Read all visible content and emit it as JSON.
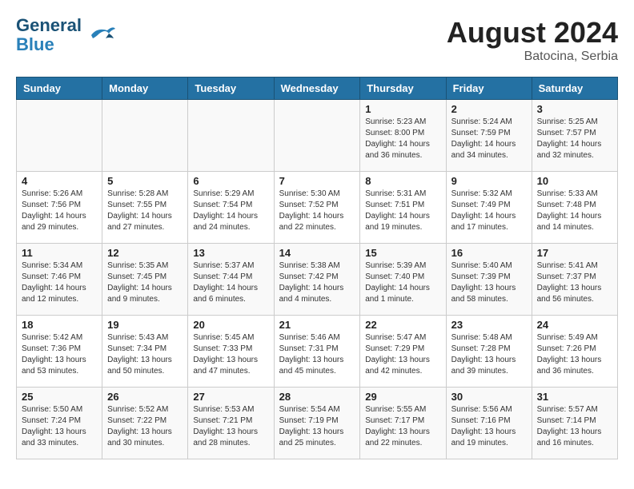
{
  "header": {
    "logo_line1": "General",
    "logo_line2": "Blue",
    "month_year": "August 2024",
    "location": "Batocina, Serbia"
  },
  "days_of_week": [
    "Sunday",
    "Monday",
    "Tuesday",
    "Wednesday",
    "Thursday",
    "Friday",
    "Saturday"
  ],
  "weeks": [
    [
      {
        "day": "",
        "info": ""
      },
      {
        "day": "",
        "info": ""
      },
      {
        "day": "",
        "info": ""
      },
      {
        "day": "",
        "info": ""
      },
      {
        "day": "1",
        "info": "Sunrise: 5:23 AM\nSunset: 8:00 PM\nDaylight: 14 hours\nand 36 minutes."
      },
      {
        "day": "2",
        "info": "Sunrise: 5:24 AM\nSunset: 7:59 PM\nDaylight: 14 hours\nand 34 minutes."
      },
      {
        "day": "3",
        "info": "Sunrise: 5:25 AM\nSunset: 7:57 PM\nDaylight: 14 hours\nand 32 minutes."
      }
    ],
    [
      {
        "day": "4",
        "info": "Sunrise: 5:26 AM\nSunset: 7:56 PM\nDaylight: 14 hours\nand 29 minutes."
      },
      {
        "day": "5",
        "info": "Sunrise: 5:28 AM\nSunset: 7:55 PM\nDaylight: 14 hours\nand 27 minutes."
      },
      {
        "day": "6",
        "info": "Sunrise: 5:29 AM\nSunset: 7:54 PM\nDaylight: 14 hours\nand 24 minutes."
      },
      {
        "day": "7",
        "info": "Sunrise: 5:30 AM\nSunset: 7:52 PM\nDaylight: 14 hours\nand 22 minutes."
      },
      {
        "day": "8",
        "info": "Sunrise: 5:31 AM\nSunset: 7:51 PM\nDaylight: 14 hours\nand 19 minutes."
      },
      {
        "day": "9",
        "info": "Sunrise: 5:32 AM\nSunset: 7:49 PM\nDaylight: 14 hours\nand 17 minutes."
      },
      {
        "day": "10",
        "info": "Sunrise: 5:33 AM\nSunset: 7:48 PM\nDaylight: 14 hours\nand 14 minutes."
      }
    ],
    [
      {
        "day": "11",
        "info": "Sunrise: 5:34 AM\nSunset: 7:46 PM\nDaylight: 14 hours\nand 12 minutes."
      },
      {
        "day": "12",
        "info": "Sunrise: 5:35 AM\nSunset: 7:45 PM\nDaylight: 14 hours\nand 9 minutes."
      },
      {
        "day": "13",
        "info": "Sunrise: 5:37 AM\nSunset: 7:44 PM\nDaylight: 14 hours\nand 6 minutes."
      },
      {
        "day": "14",
        "info": "Sunrise: 5:38 AM\nSunset: 7:42 PM\nDaylight: 14 hours\nand 4 minutes."
      },
      {
        "day": "15",
        "info": "Sunrise: 5:39 AM\nSunset: 7:40 PM\nDaylight: 14 hours\nand 1 minute."
      },
      {
        "day": "16",
        "info": "Sunrise: 5:40 AM\nSunset: 7:39 PM\nDaylight: 13 hours\nand 58 minutes."
      },
      {
        "day": "17",
        "info": "Sunrise: 5:41 AM\nSunset: 7:37 PM\nDaylight: 13 hours\nand 56 minutes."
      }
    ],
    [
      {
        "day": "18",
        "info": "Sunrise: 5:42 AM\nSunset: 7:36 PM\nDaylight: 13 hours\nand 53 minutes."
      },
      {
        "day": "19",
        "info": "Sunrise: 5:43 AM\nSunset: 7:34 PM\nDaylight: 13 hours\nand 50 minutes."
      },
      {
        "day": "20",
        "info": "Sunrise: 5:45 AM\nSunset: 7:33 PM\nDaylight: 13 hours\nand 47 minutes."
      },
      {
        "day": "21",
        "info": "Sunrise: 5:46 AM\nSunset: 7:31 PM\nDaylight: 13 hours\nand 45 minutes."
      },
      {
        "day": "22",
        "info": "Sunrise: 5:47 AM\nSunset: 7:29 PM\nDaylight: 13 hours\nand 42 minutes."
      },
      {
        "day": "23",
        "info": "Sunrise: 5:48 AM\nSunset: 7:28 PM\nDaylight: 13 hours\nand 39 minutes."
      },
      {
        "day": "24",
        "info": "Sunrise: 5:49 AM\nSunset: 7:26 PM\nDaylight: 13 hours\nand 36 minutes."
      }
    ],
    [
      {
        "day": "25",
        "info": "Sunrise: 5:50 AM\nSunset: 7:24 PM\nDaylight: 13 hours\nand 33 minutes."
      },
      {
        "day": "26",
        "info": "Sunrise: 5:52 AM\nSunset: 7:22 PM\nDaylight: 13 hours\nand 30 minutes."
      },
      {
        "day": "27",
        "info": "Sunrise: 5:53 AM\nSunset: 7:21 PM\nDaylight: 13 hours\nand 28 minutes."
      },
      {
        "day": "28",
        "info": "Sunrise: 5:54 AM\nSunset: 7:19 PM\nDaylight: 13 hours\nand 25 minutes."
      },
      {
        "day": "29",
        "info": "Sunrise: 5:55 AM\nSunset: 7:17 PM\nDaylight: 13 hours\nand 22 minutes."
      },
      {
        "day": "30",
        "info": "Sunrise: 5:56 AM\nSunset: 7:16 PM\nDaylight: 13 hours\nand 19 minutes."
      },
      {
        "day": "31",
        "info": "Sunrise: 5:57 AM\nSunset: 7:14 PM\nDaylight: 13 hours\nand 16 minutes."
      }
    ]
  ]
}
